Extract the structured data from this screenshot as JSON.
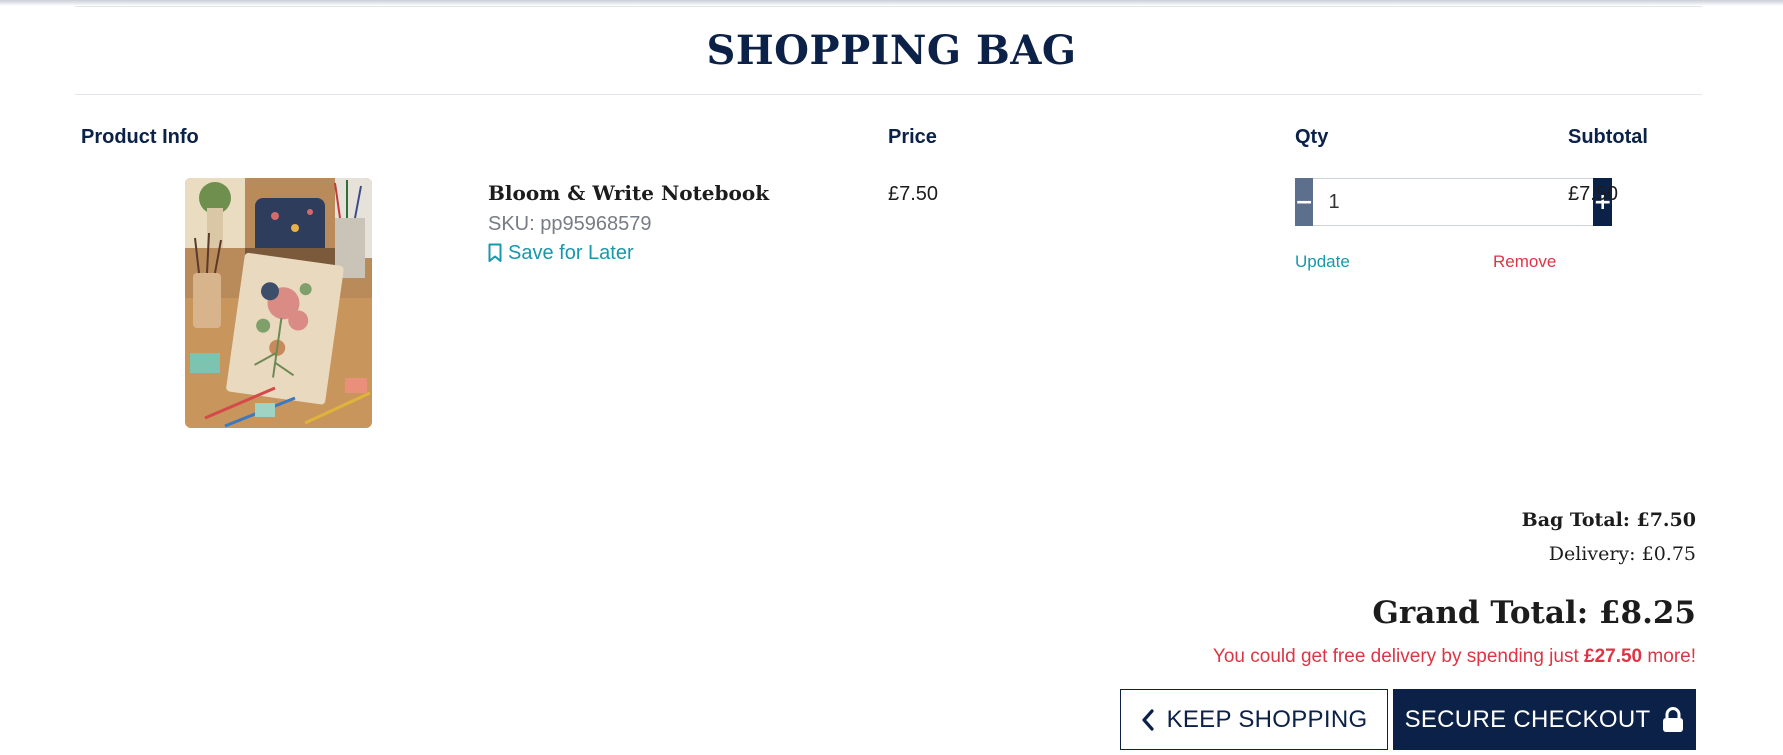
{
  "page": {
    "title": "SHOPPING BAG"
  },
  "table": {
    "headers": {
      "product_info": "Product Info",
      "price": "Price",
      "qty": "Qty",
      "subtotal": "Subtotal"
    },
    "items": [
      {
        "name": "Bloom & Write Notebook",
        "sku": "SKU: pp95968579",
        "save_label": "Save for Later",
        "price": "£7.50",
        "quantity": "1",
        "update_label": "Update",
        "remove_label": "Remove",
        "subtotal": "£7.50",
        "image_icon": "floral-notebook-image"
      }
    ]
  },
  "summary": {
    "bag_total": "Bag Total: £7.50",
    "delivery": "Delivery: £0.75",
    "grand_total": "Grand Total: £8.25",
    "free_delivery_prefix": "You could get free delivery by spending just ",
    "free_delivery_amount": "£27.50",
    "free_delivery_suffix": " more!"
  },
  "actions": {
    "keep_shopping": "KEEP SHOPPING",
    "secure_checkout": "SECURE CHECKOUT"
  },
  "icons": {
    "save": "bookmark-icon",
    "minus": "minus-icon",
    "plus": "plus-icon",
    "back": "chevron-left-icon",
    "lock": "lock-icon"
  },
  "colors": {
    "brand_navy": "#0b2147",
    "link_teal": "#1798ab",
    "danger_red": "#dc3545",
    "stepper_gray": "#5c6f8c"
  }
}
